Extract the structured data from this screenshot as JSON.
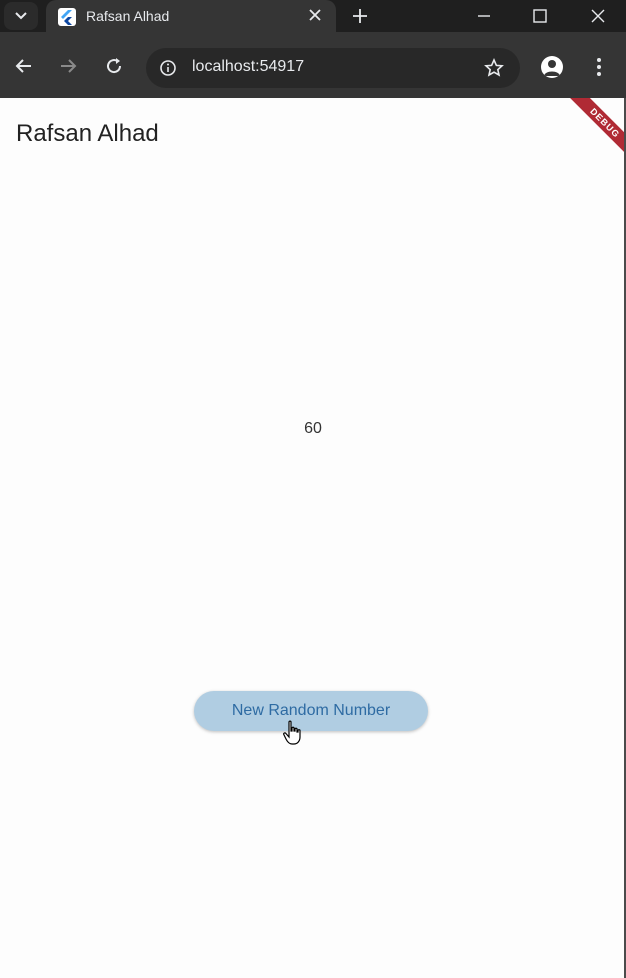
{
  "browser": {
    "tab_title": "Rafsan Alhad",
    "url": "localhost:54917",
    "accent": "#1f1f1f"
  },
  "app": {
    "title": "Rafsan Alhad",
    "random_number": "60",
    "button_label": "New Random Number",
    "debug_label": "DEBUG",
    "button_color": "#b0cde2",
    "button_text_color": "#2e6ba3"
  }
}
